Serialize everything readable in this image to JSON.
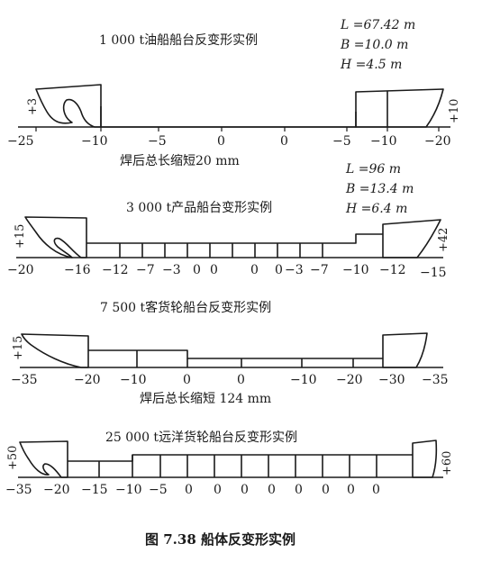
{
  "figure_caption": "图 7.38   船体反变形实例",
  "examples": [
    {
      "title": "1 000 t油船船台反变形实例",
      "dims": [
        "L =67.42 m",
        "B =10.0 m",
        "H =4.5 m"
      ],
      "stern_value": "+3",
      "bow_value": "+10",
      "axis_labels": [
        "−25",
        "−10",
        "−5",
        "0",
        "0",
        "−5",
        "−10",
        "−20"
      ],
      "note": "焊后总长缩短20 mm"
    },
    {
      "title": "3 000 t产品船台变形实例",
      "dims": [
        "L =96 m",
        "B =13.4 m",
        "H =6.4 m"
      ],
      "stern_value": "+15",
      "bow_value": "+42",
      "axis_labels": [
        "−20",
        "−16",
        "−12",
        "−7",
        "−3",
        "0",
        "0",
        "0",
        "0",
        "−3",
        "−7",
        "−10",
        "−12",
        "−15"
      ],
      "note": ""
    },
    {
      "title": "7 500 t客货轮船台反变形实例",
      "dims": [],
      "stern_value": "+15",
      "bow_value": "",
      "axis_labels": [
        "−35",
        "−20",
        "−10",
        "0",
        "0",
        "−10",
        "−20",
        "−30",
        "−35"
      ],
      "note": "焊后总长缩短 124 mm"
    },
    {
      "title": "25 000 t远洋货轮船台反变形实例",
      "dims": [],
      "stern_value": "+50",
      "bow_value": "+60",
      "axis_labels": [
        "−35",
        "−20",
        "−15",
        "−10",
        "−5",
        "0",
        "0",
        "0",
        "0",
        "0",
        "0",
        "0",
        "0"
      ],
      "note": ""
    }
  ]
}
